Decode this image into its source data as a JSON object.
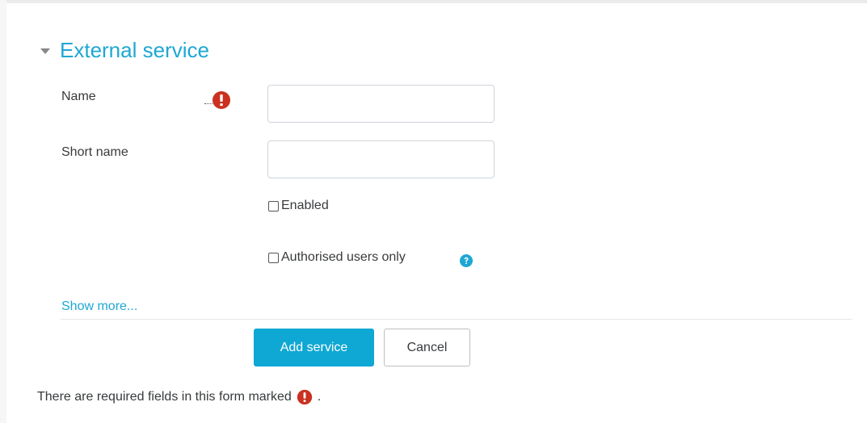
{
  "form": {
    "legend": "External service",
    "fields": {
      "name": {
        "label": "Name",
        "value": "",
        "placeholder": ""
      },
      "short_name": {
        "label": "Short name",
        "value": "",
        "placeholder": ""
      }
    },
    "checkboxes": {
      "enabled": {
        "label": "Enabled",
        "checked": false
      },
      "authorised": {
        "label": "Authorised users only",
        "checked": false
      }
    },
    "show_more": "Show more...",
    "buttons": {
      "submit": "Add service",
      "cancel": "Cancel"
    },
    "required_note": {
      "before": "There are required fields in this form marked",
      "after": "."
    }
  },
  "icons": {
    "required": "exclamation-circle-icon",
    "help": "question-circle-icon",
    "collapse": "caret-down-icon"
  },
  "colors": {
    "accent": "#1ea7d3",
    "primary_button": "#0fa7d3",
    "required": "#ca3120"
  }
}
